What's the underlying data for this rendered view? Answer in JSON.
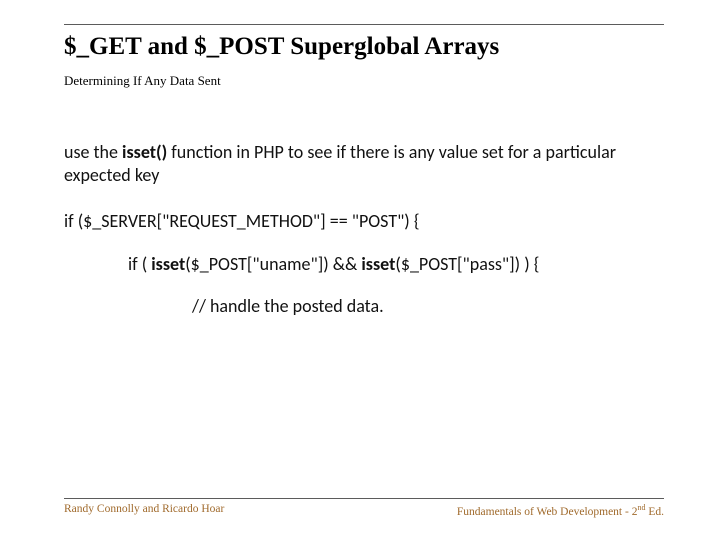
{
  "title": "$_GET and $_POST Superglobal Arrays",
  "subtitle": "Determining If Any Data Sent",
  "body": {
    "intro_pre": "use the ",
    "intro_bold": "isset()",
    "intro_post": "  function in PHP to see if there is any value set for a particular expected key",
    "line1": "if ($_SERVER[\"REQUEST_METHOD\"] == \"POST\") {",
    "line2_a": "if ( ",
    "line2_b1": "isset",
    "line2_c": "($_POST[\"uname\"]) && ",
    "line2_b2": "isset",
    "line2_d": "($_POST[\"pass\"]) ) {",
    "line3": "// handle the posted data."
  },
  "footer": {
    "left": "Randy Connolly and Ricardo Hoar",
    "right_pre": "Fundamentals of Web Development - 2",
    "right_sup": "nd",
    "right_post": " Ed."
  }
}
